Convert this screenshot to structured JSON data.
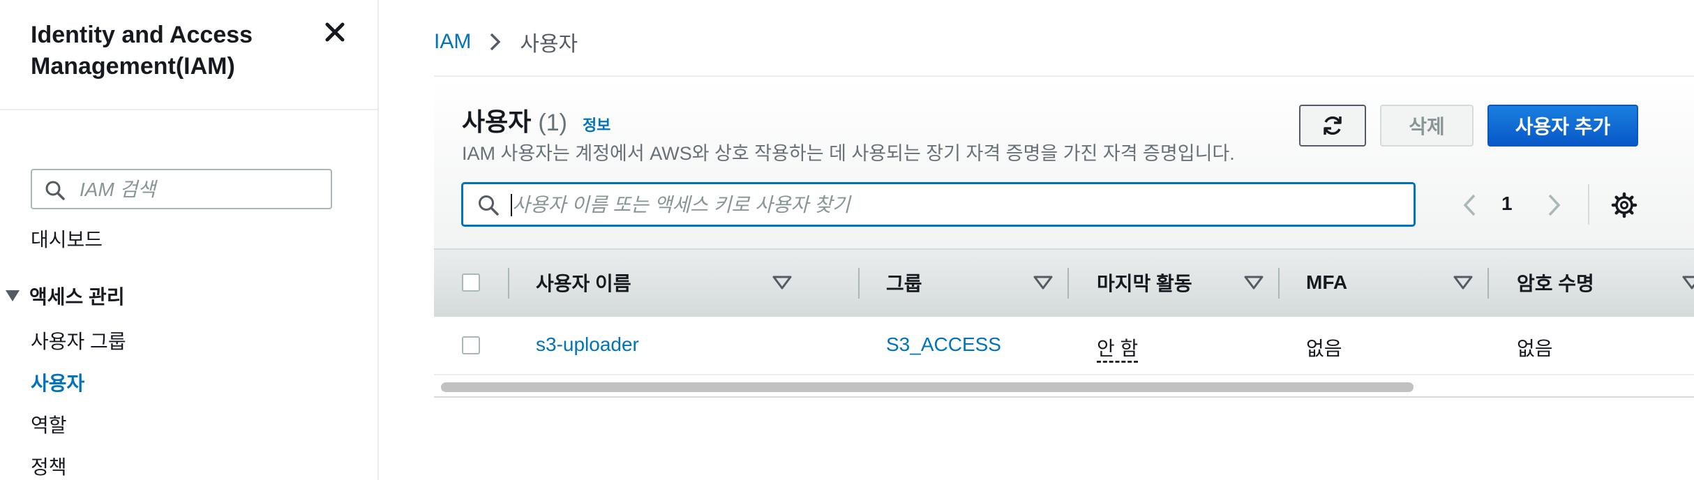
{
  "sidebar": {
    "title": "Identity and Access Management(IAM)",
    "search_placeholder": "IAM 검색",
    "dashboard": "대시보드",
    "section_access": "액세스 관리",
    "items": [
      {
        "label": "사용자 그룹"
      },
      {
        "label": "사용자"
      },
      {
        "label": "역할"
      },
      {
        "label": "정책"
      }
    ]
  },
  "breadcrumb": {
    "root": "IAM",
    "current": "사용자"
  },
  "header": {
    "title": "사용자",
    "count": "(1)",
    "info": "정보",
    "description": "IAM 사용자는 계정에서 AWS와 상호 작용하는 데 사용되는 장기 자격 증명을 가진 자격 증명입니다.",
    "delete_label": "삭제",
    "add_label": "사용자 추가"
  },
  "filter": {
    "placeholder": "사용자 이름 또는 액세스 키로 사용자 찾기"
  },
  "pagination": {
    "page": "1"
  },
  "table": {
    "columns": [
      "사용자 이름",
      "그룹",
      "마지막 활동",
      "MFA",
      "암호 수명"
    ],
    "rows": [
      {
        "user": "s3-uploader",
        "group": "S3_ACCESS",
        "last_activity": "안 함",
        "mfa": "없음",
        "password_age": "없음"
      }
    ]
  },
  "colors": {
    "accent": "#0073bb",
    "primary_button": "#0972d3"
  }
}
